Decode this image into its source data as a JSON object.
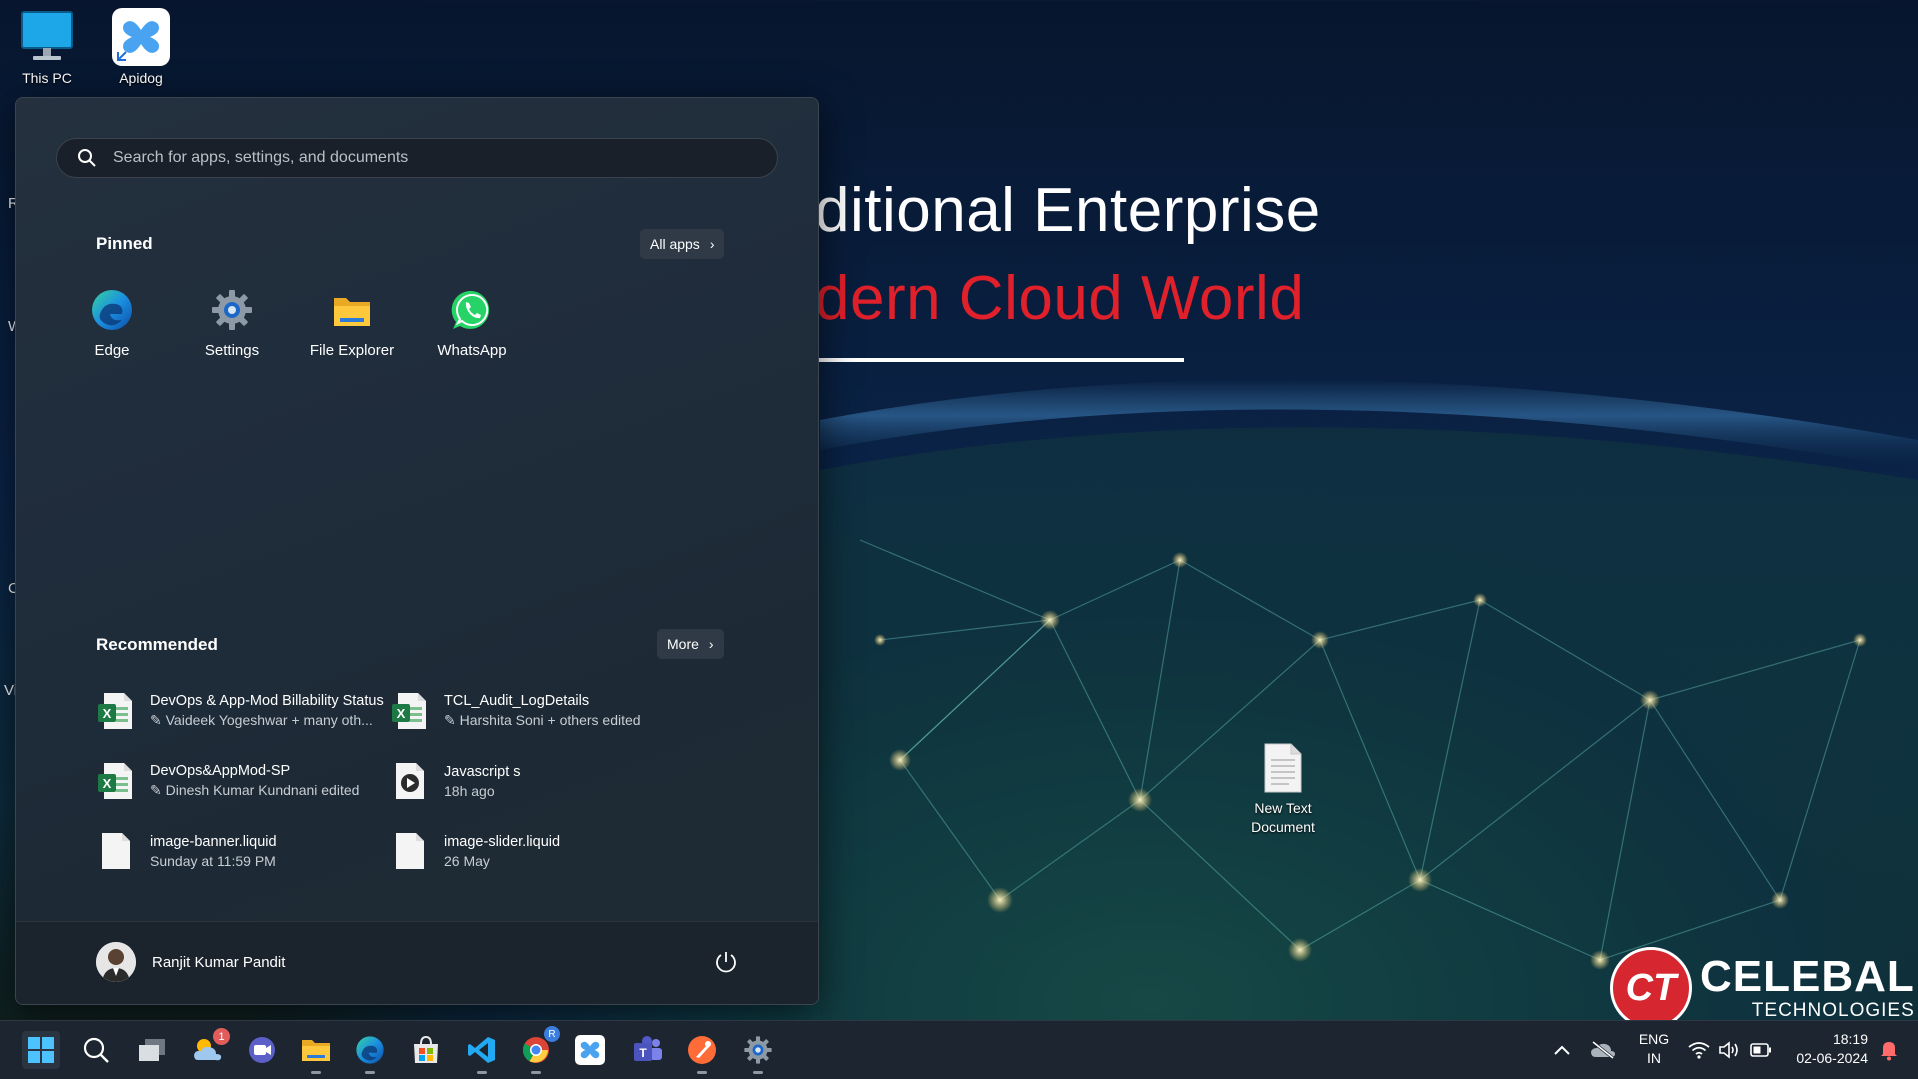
{
  "desktop": {
    "icons": [
      {
        "label": "This PC",
        "icon": "monitor-icon"
      },
      {
        "label": "Apidog",
        "icon": "apidog-icon"
      }
    ],
    "new_text_document": {
      "label_line1": "New Text",
      "label_line2": "Document"
    },
    "banner": {
      "line1": "aditional Enterprise",
      "line2": "odern Cloud World",
      "line2_color": "#e0202a"
    },
    "logo": {
      "mark": "CT",
      "name": "CELEBAL",
      "sub": "TECHNOLOGIES",
      "brand_color": "#d6262f"
    },
    "edge_letters": [
      "R",
      "W",
      "C",
      "Vi"
    ]
  },
  "start_menu": {
    "search": {
      "placeholder": "Search for apps, settings, and documents"
    },
    "pinned": {
      "title": "Pinned",
      "all_apps_label": "All apps",
      "apps": [
        {
          "label": "Edge",
          "icon": "edge-icon"
        },
        {
          "label": "Settings",
          "icon": "settings-gear-icon"
        },
        {
          "label": "File Explorer",
          "icon": "folder-icon"
        },
        {
          "label": "WhatsApp",
          "icon": "whatsapp-icon"
        }
      ]
    },
    "recommended": {
      "title": "Recommended",
      "more_label": "More",
      "items": [
        {
          "name": "DevOps & App-Mod Billability Status",
          "detail": "Vaideek Yogeshwar + many oth...",
          "icon": "excel-icon",
          "edited": true
        },
        {
          "name": "TCL_Audit_LogDetails",
          "detail": "Harshita Soni + others edited",
          "icon": "excel-icon",
          "edited": true
        },
        {
          "name": "DevOps&AppMod-SP",
          "detail": "Dinesh Kumar Kundnani edited",
          "icon": "excel-icon",
          "edited": true
        },
        {
          "name": "Javascript s",
          "detail": "18h ago",
          "icon": "video-icon",
          "edited": false
        },
        {
          "name": "image-banner.liquid",
          "detail": "Sunday at 11:59 PM",
          "icon": "file-icon",
          "edited": false
        },
        {
          "name": "image-slider.liquid",
          "detail": "26 May",
          "icon": "file-icon",
          "edited": false
        }
      ]
    },
    "user": {
      "name": "Ranjit Kumar Pandit"
    }
  },
  "taskbar": {
    "apps": [
      {
        "name": "start",
        "icon": "windows-logo-icon"
      },
      {
        "name": "search",
        "icon": "search-icon"
      },
      {
        "name": "task-view",
        "icon": "task-view-icon"
      },
      {
        "name": "widgets",
        "icon": "weather-widget-icon",
        "badge": "1"
      },
      {
        "name": "meet",
        "icon": "video-camera-icon"
      },
      {
        "name": "file-explorer",
        "icon": "folder-icon"
      },
      {
        "name": "edge",
        "icon": "edge-icon"
      },
      {
        "name": "store",
        "icon": "store-icon"
      },
      {
        "name": "vscode",
        "icon": "vscode-icon"
      },
      {
        "name": "chrome",
        "icon": "chrome-icon",
        "badge": "R"
      },
      {
        "name": "apidog",
        "icon": "apidog-icon"
      },
      {
        "name": "teams",
        "icon": "teams-icon"
      },
      {
        "name": "postman",
        "icon": "postman-icon"
      },
      {
        "name": "settings",
        "icon": "settings-gear-icon"
      }
    ],
    "tray": {
      "lang_line1": "ENG",
      "lang_line2": "IN",
      "time": "18:19",
      "date": "02-06-2024"
    }
  }
}
